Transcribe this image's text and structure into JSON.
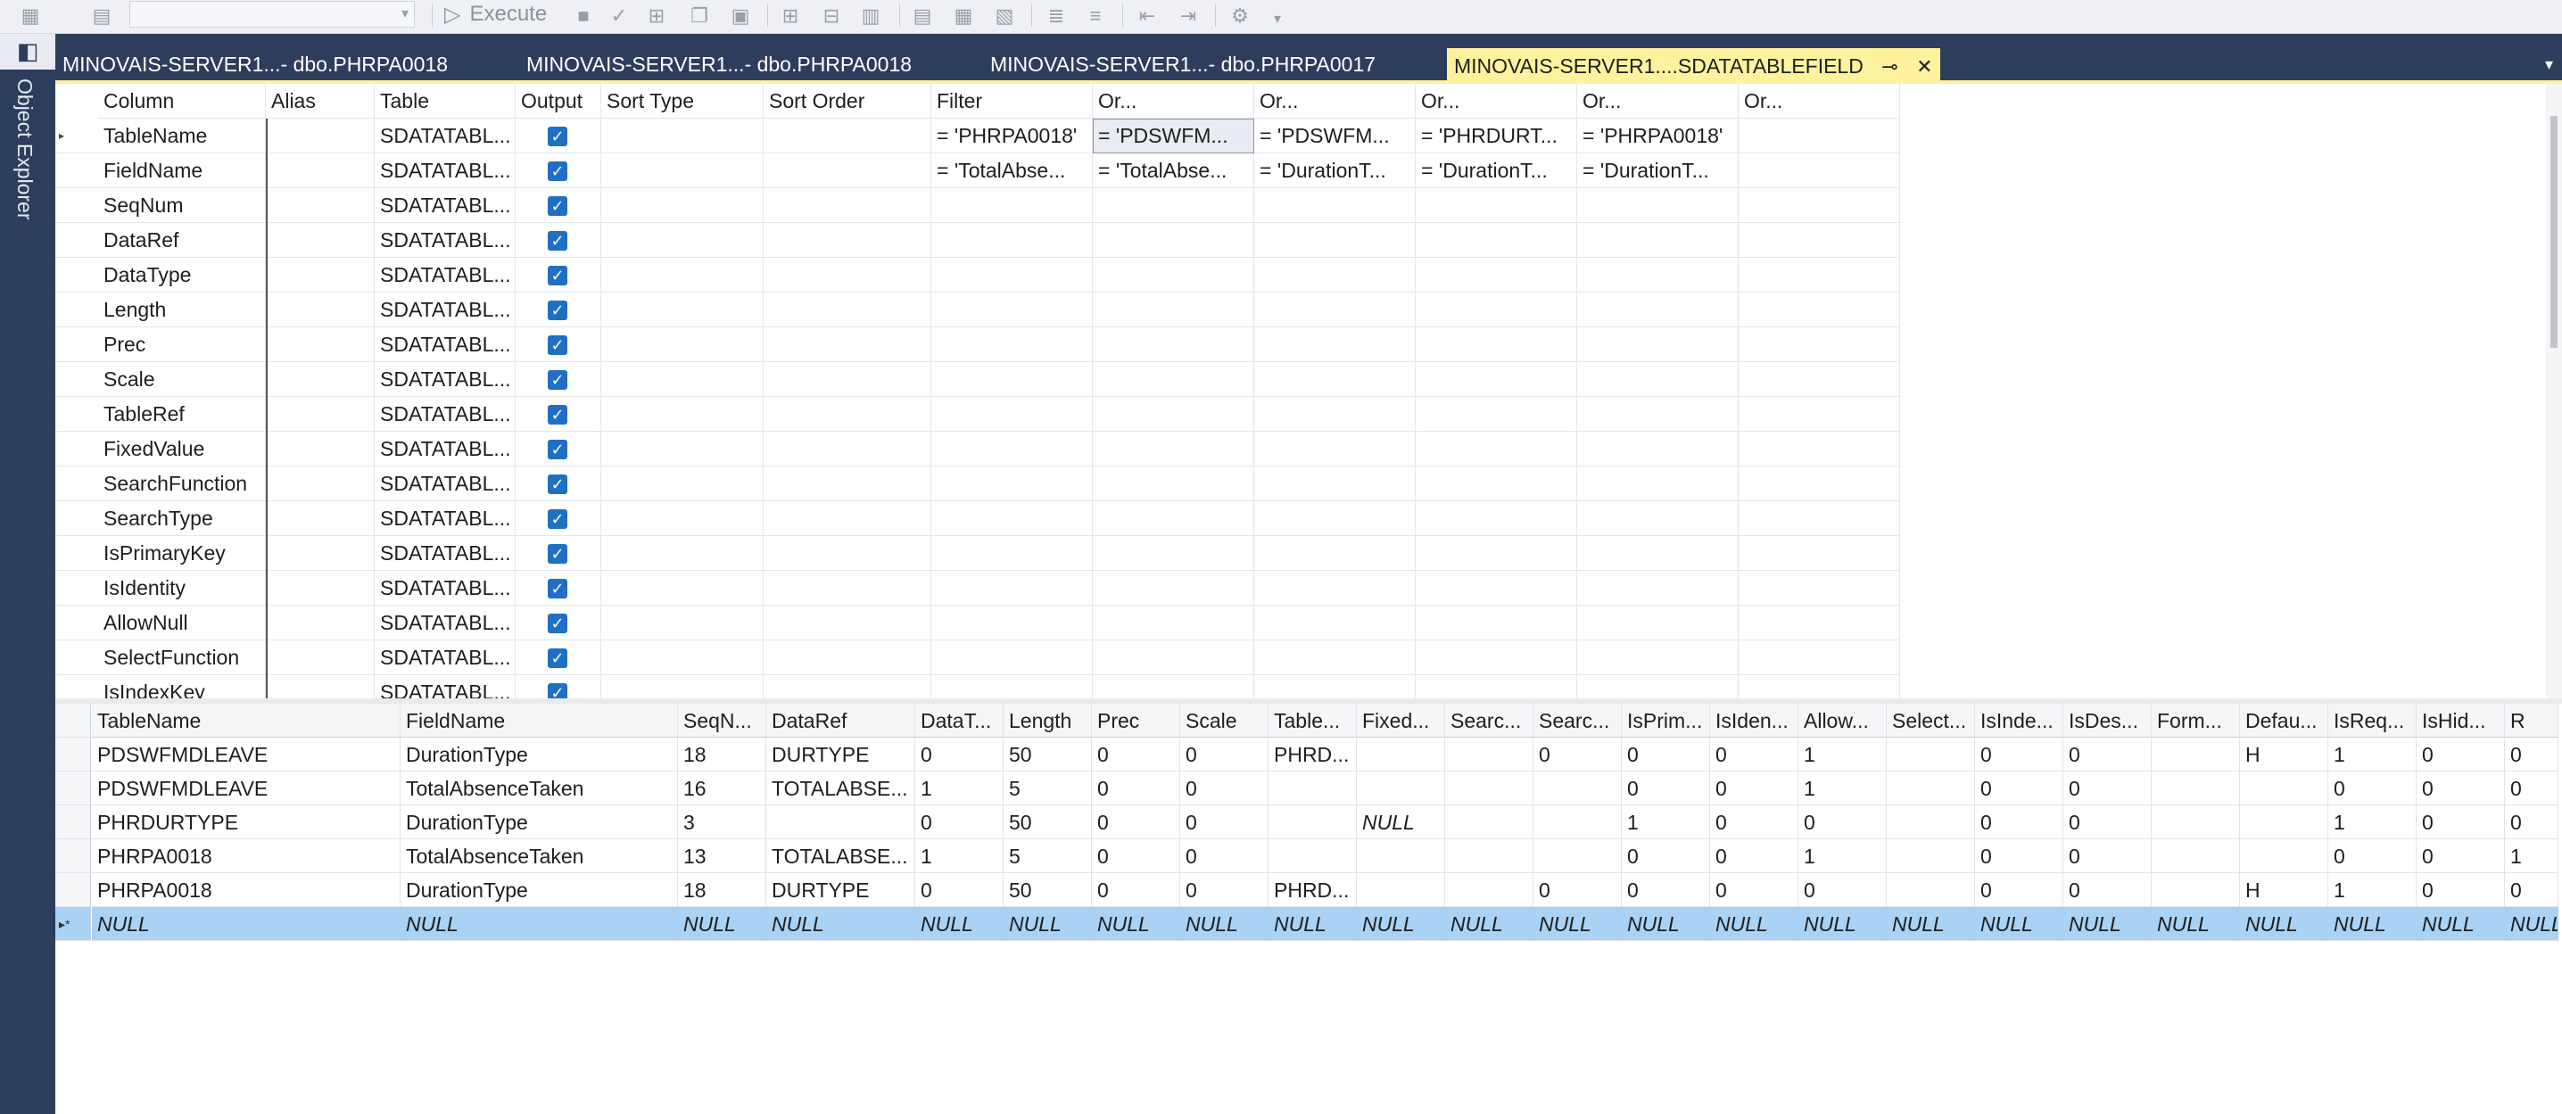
{
  "toolbar": {
    "execute_label": "Execute"
  },
  "object_explorer": {
    "label": "Object Explorer"
  },
  "tabs": [
    {
      "label": "MINOVAIS-SERVER1...- dbo.PHRPA0018"
    },
    {
      "label": "MINOVAIS-SERVER1...- dbo.PHRPA0018"
    },
    {
      "label": "MINOVAIS-SERVER1...- dbo.PHRPA0017"
    },
    {
      "label": "MINOVAIS-SERVER1....SDATATABLEFIELD"
    }
  ],
  "criteria": {
    "headers": [
      "Column",
      "Alias",
      "Table",
      "Output",
      "Sort Type",
      "Sort Order",
      "Filter",
      "Or...",
      "Or...",
      "Or...",
      "Or...",
      "Or..."
    ],
    "rows": [
      {
        "column": "TableName",
        "alias": "",
        "table": "SDATATABL...",
        "output": true,
        "filter": "= 'PHRPA0018'",
        "or1": "= 'PDSWFM...",
        "or2": "= 'PDSWFM...",
        "or3": "= 'PHRDURT...",
        "or4": "= 'PHRPA0018'"
      },
      {
        "column": "FieldName",
        "alias": "",
        "table": "SDATATABL...",
        "output": true,
        "filter": "= 'TotalAbse...",
        "or1": "= 'TotalAbse...",
        "or2": "= 'DurationT...",
        "or3": "= 'DurationT...",
        "or4": "= 'DurationT..."
      },
      {
        "column": "SeqNum",
        "table": "SDATATABL...",
        "output": true
      },
      {
        "column": "DataRef",
        "table": "SDATATABL...",
        "output": true
      },
      {
        "column": "DataType",
        "table": "SDATATABL...",
        "output": true
      },
      {
        "column": "Length",
        "table": "SDATATABL...",
        "output": true
      },
      {
        "column": "Prec",
        "table": "SDATATABL...",
        "output": true
      },
      {
        "column": "Scale",
        "table": "SDATATABL...",
        "output": true
      },
      {
        "column": "TableRef",
        "table": "SDATATABL...",
        "output": true
      },
      {
        "column": "FixedValue",
        "table": "SDATATABL...",
        "output": true
      },
      {
        "column": "SearchFunction",
        "table": "SDATATABL...",
        "output": true
      },
      {
        "column": "SearchType",
        "table": "SDATATABL...",
        "output": true
      },
      {
        "column": "IsPrimaryKey",
        "table": "SDATATABL...",
        "output": true
      },
      {
        "column": "IsIdentity",
        "table": "SDATATABL...",
        "output": true
      },
      {
        "column": "AllowNull",
        "table": "SDATATABL...",
        "output": true
      },
      {
        "column": "SelectFunction",
        "table": "SDATATABL...",
        "output": true
      },
      {
        "column": "IsIndexKey",
        "table": "SDATATABL...",
        "output": true
      }
    ]
  },
  "results": {
    "headers": [
      "TableName",
      "FieldName",
      "SeqN...",
      "DataRef",
      "DataT...",
      "Length",
      "Prec",
      "Scale",
      "Table...",
      "Fixed...",
      "Searc...",
      "Searc...",
      "IsPrim...",
      "IsIden...",
      "Allow...",
      "Select...",
      "IsInde...",
      "IsDes...",
      "Form...",
      "Defau...",
      "IsReq...",
      "IsHid...",
      "R"
    ],
    "rows": [
      [
        "PDSWFMDLEAVE",
        "DurationType",
        "18",
        "DURTYPE",
        "0",
        "50",
        "0",
        "0",
        "PHRD...",
        "",
        "",
        "0",
        "0",
        "0",
        "1",
        "",
        "0",
        "0",
        "",
        "H",
        "1",
        "0",
        "0"
      ],
      [
        "PDSWFMDLEAVE",
        "TotalAbsenceTaken",
        "16",
        "TOTALABSE...",
        "1",
        "5",
        "0",
        "0",
        "",
        "",
        "",
        "",
        "0",
        "0",
        "1",
        "",
        "0",
        "0",
        "",
        "",
        "0",
        "0",
        "0"
      ],
      [
        "PHRDURTYPE",
        "DurationType",
        "3",
        "",
        "0",
        "50",
        "0",
        "0",
        "",
        "NULL",
        "",
        "",
        "1",
        "0",
        "0",
        "",
        "0",
        "0",
        "",
        "",
        "1",
        "0",
        "0"
      ],
      [
        "PHRPA0018",
        "TotalAbsenceTaken",
        "13",
        "TOTALABSE...",
        "1",
        "5",
        "0",
        "0",
        "",
        "",
        "",
        "",
        "0",
        "0",
        "1",
        "",
        "0",
        "0",
        "",
        "",
        "0",
        "0",
        "1"
      ],
      [
        "PHRPA0018",
        "DurationType",
        "18",
        "DURTYPE",
        "0",
        "50",
        "0",
        "0",
        "PHRD...",
        "",
        "",
        "0",
        "0",
        "0",
        "0",
        "",
        "0",
        "0",
        "",
        "H",
        "1",
        "0",
        "0"
      ]
    ],
    "new_row_marker": "▸*",
    "null_label": "NULL"
  }
}
